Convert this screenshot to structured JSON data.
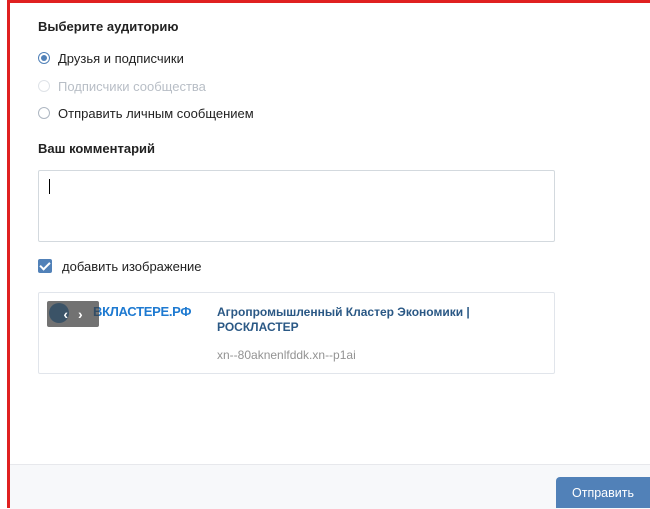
{
  "audience": {
    "title": "Выберите аудиторию",
    "options": [
      {
        "label": "Друзья и подписчики",
        "state": "checked"
      },
      {
        "label": "Подписчики сообщества",
        "state": "disabled"
      },
      {
        "label": "Отправить личным сообщением",
        "state": "unchecked"
      }
    ]
  },
  "comment": {
    "title": "Ваш комментарий",
    "value": ""
  },
  "add_image": {
    "label": "добавить изображение",
    "checked": true
  },
  "preview": {
    "logo_text": "ВКЛАСТЕРЕ.РФ",
    "nav_prev": "‹",
    "nav_next": "›",
    "title": "Агропромышленный Кластер Экономики | РОСКЛАСТЕР",
    "domain": "xn--80aknenlfddk.xn--p1ai"
  },
  "footer": {
    "send_label": "Отправить"
  },
  "colors": {
    "accent": "#5181b8",
    "link": "#2a5885",
    "frame": "#e02020"
  }
}
